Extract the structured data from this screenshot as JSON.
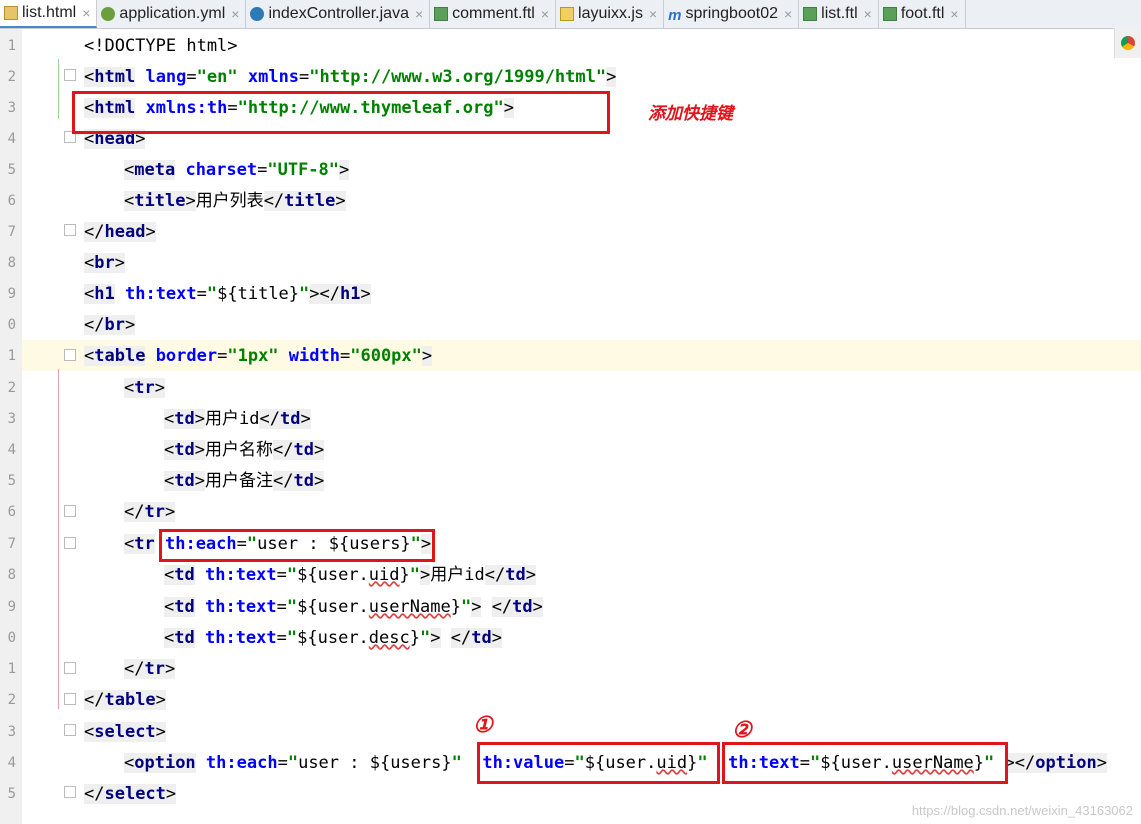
{
  "tabs": [
    {
      "label": "list.html",
      "icon": "html-file-icon",
      "active": true
    },
    {
      "label": "application.yml",
      "icon": "yml-file-icon"
    },
    {
      "label": "indexController.java",
      "icon": "java-class-icon"
    },
    {
      "label": "comment.ftl",
      "icon": "ftl-file-icon"
    },
    {
      "label": "layuixx.js",
      "icon": "js-file-icon"
    },
    {
      "label": "springboot02",
      "icon": "maven-module-icon"
    },
    {
      "label": "list.ftl",
      "icon": "ftl-file-icon"
    },
    {
      "label": "foot.ftl",
      "icon": "ftl-file-icon"
    }
  ],
  "tab_close_glyph": "×",
  "line_numbers": [
    "1",
    "2",
    "3",
    "4",
    "5",
    "6",
    "7",
    "8",
    "9",
    "0",
    "1",
    "2",
    "3",
    "4",
    "5",
    "6",
    "7",
    "8",
    "9",
    "0",
    "1",
    "2",
    "3",
    "4",
    "5"
  ],
  "code": {
    "l1": "<!DOCTYPE html>",
    "l2_tag": "html",
    "l2_a1": "lang",
    "l2_v1": "\"en\"",
    "l2_a2": "xmlns",
    "l2_v2": "\"http://www.w3.org/1999/html\"",
    "l3_tag": "html",
    "l3_a1": "xmlns:th",
    "l3_v1": "\"http://www.thymeleaf.org\"",
    "l4_tag": "head",
    "l5_tag": "meta",
    "l5_a1": "charset",
    "l5_v1": "\"UTF-8\"",
    "l6_tag": "title",
    "l6_text": "用户列表",
    "l7_tag": "head",
    "l8_tag": "br",
    "l9_tag": "h1",
    "l9_a1": "th:text",
    "l9_v1": "${title}",
    "l10_tag": "br",
    "l11_tag": "table",
    "l11_a1": "border",
    "l11_v1": "\"1px\"",
    "l11_a2": "width",
    "l11_v2": "\"600px\"",
    "l12_tag": "tr",
    "l13_tag": "td",
    "l13_text": "用户id",
    "l14_tag": "td",
    "l14_text": "用户名称",
    "l15_tag": "td",
    "l15_text": "用户备注",
    "l16_tag": "tr",
    "l17_tag": "tr",
    "l17_a1": "th:each",
    "l17_v1": "user : ${users}",
    "l18_tag": "td",
    "l18_a1": "th:text",
    "l18_v1a": "${user.",
    "l18_v1b": "uid",
    "l18_text": "用户id",
    "l19_tag": "td",
    "l19_a1": "th:text",
    "l19_v1a": "${user.",
    "l19_v1b": "userName",
    "l20_tag": "td",
    "l20_a1": "th:text",
    "l20_v1a": "${user.",
    "l20_v1b": "desc",
    "l21_tag": "tr",
    "l22_tag": "table",
    "l23_tag": "select",
    "l24_tag": "option",
    "l24_a1": "th:each",
    "l24_v1": "user : ${users}",
    "l24_a2": "th:value",
    "l24_v2a": "${user.",
    "l24_v2b": "uid",
    "l24_a3": "th:text",
    "l24_v3a": "${user.",
    "l24_v3b": "userName",
    "l24_close": "option",
    "l25_tag": "select"
  },
  "annotations": {
    "shortcut_note": "添加快捷键",
    "marker_1": "①",
    "marker_2": "②"
  },
  "watermark": "https://blog.csdn.net/weixin_43163062",
  "colors": {
    "highlight_red": "#e0141b",
    "tag_blue": "#000080",
    "attr_blue": "#0000ff",
    "string_green": "#008000"
  }
}
